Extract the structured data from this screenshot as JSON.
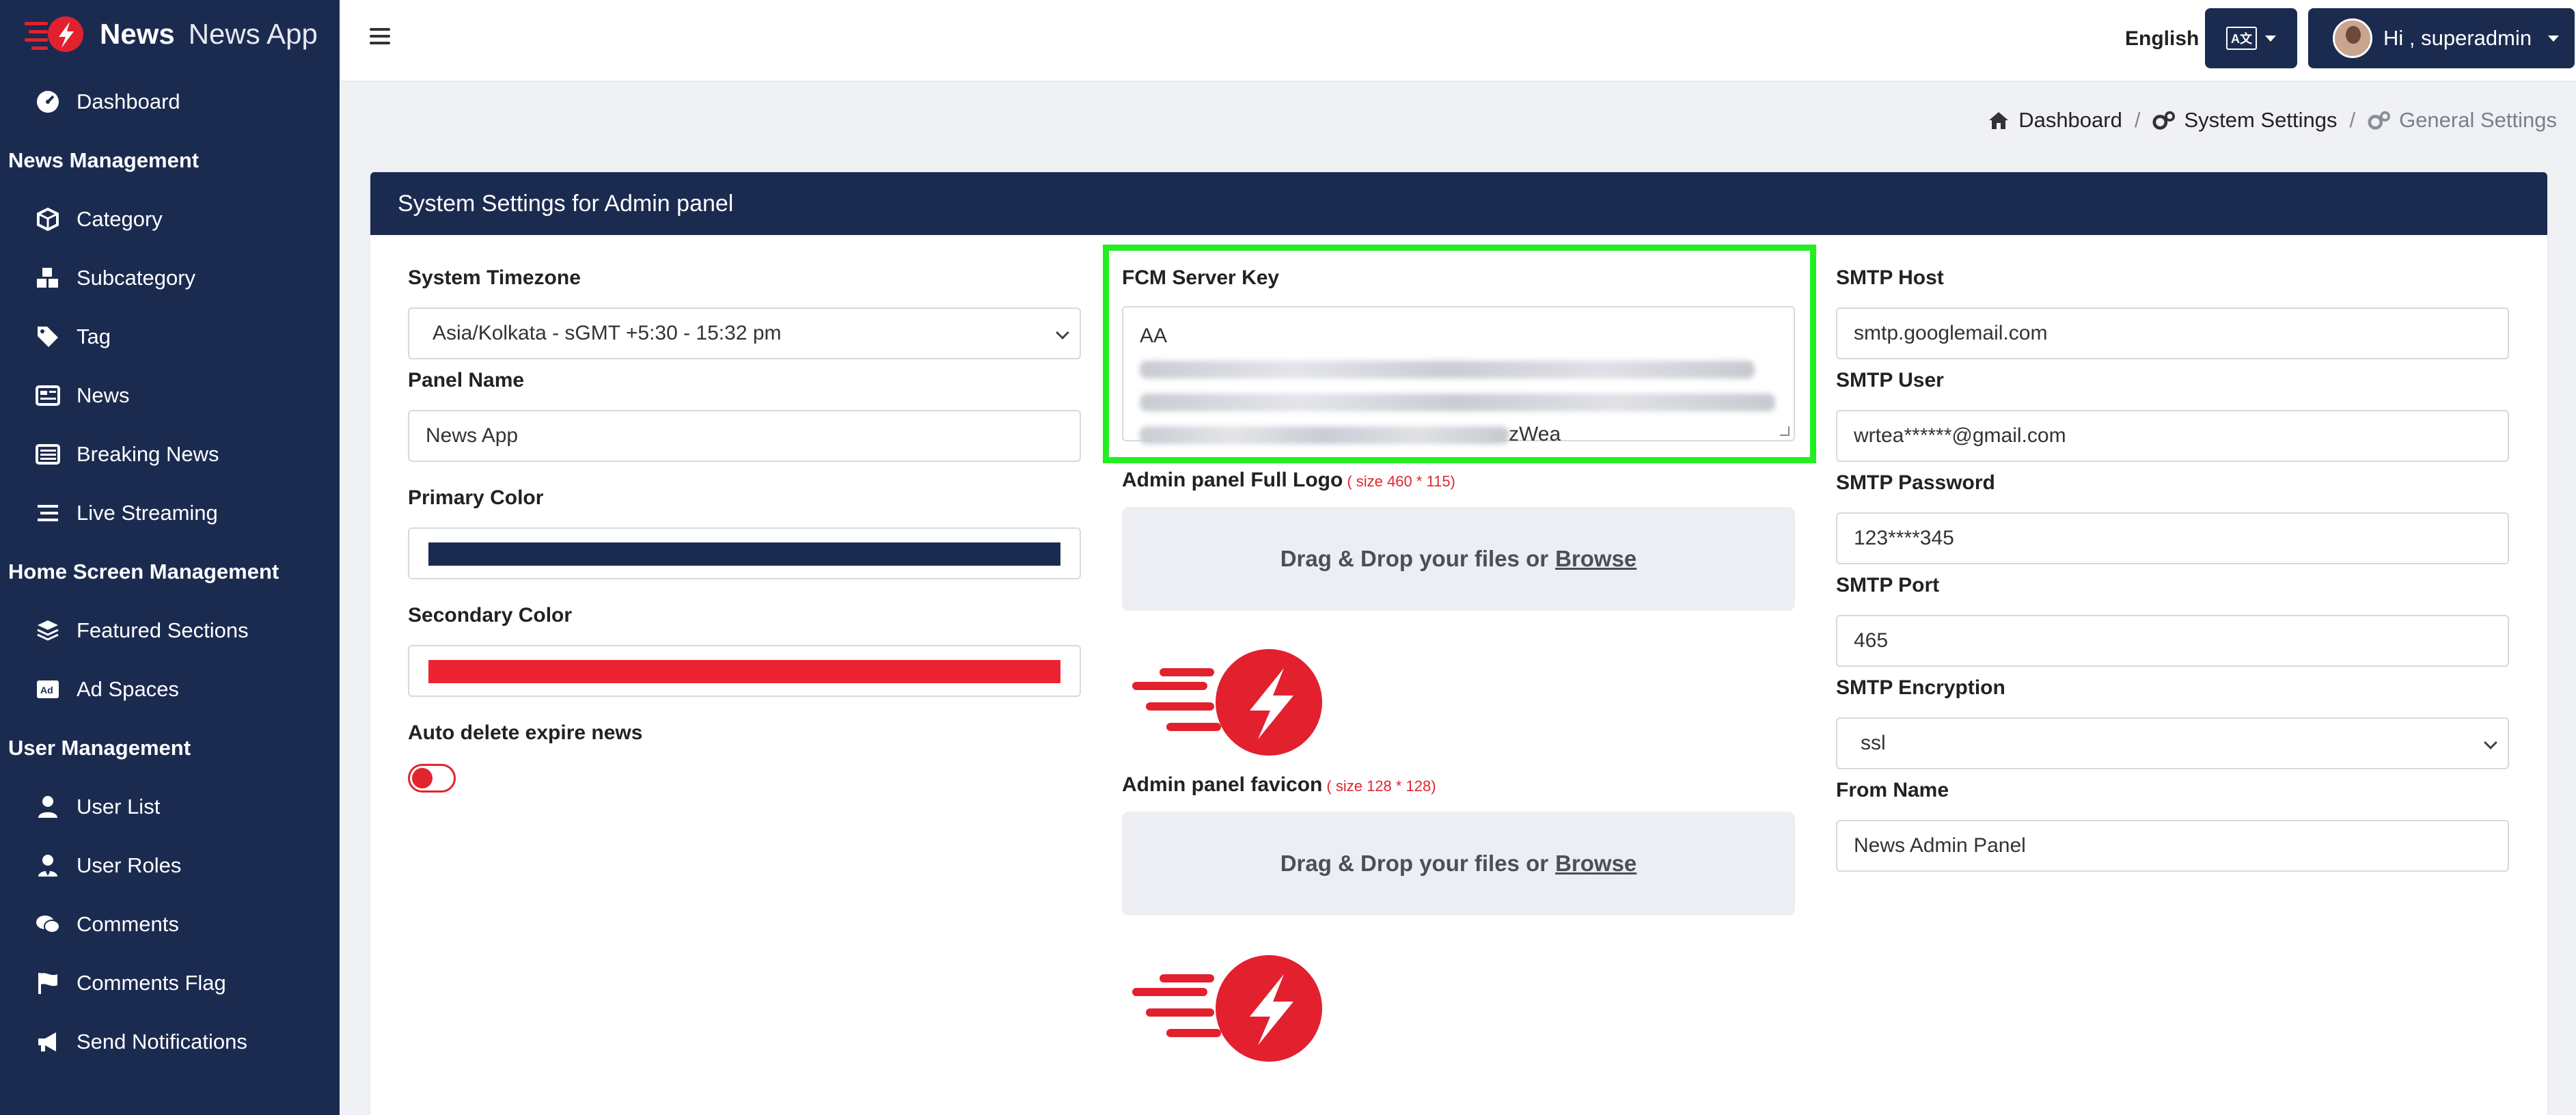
{
  "brand": {
    "name": "News",
    "subtitle": "News App"
  },
  "sidebar": {
    "dashboard": "Dashboard",
    "sections": [
      {
        "heading": "News Management",
        "items": [
          "Category",
          "Subcategory",
          "Tag",
          "News",
          "Breaking News",
          "Live Streaming"
        ]
      },
      {
        "heading": "Home Screen Management",
        "items": [
          "Featured Sections",
          "Ad Spaces"
        ]
      },
      {
        "heading": "User Management",
        "items": [
          "User List",
          "User Roles",
          "Comments",
          "Comments Flag",
          "Send Notifications"
        ]
      }
    ]
  },
  "topbar": {
    "language": "English",
    "lang_button_text": "A文",
    "user_greeting": "Hi , superadmin"
  },
  "breadcrumb": {
    "home": "Dashboard",
    "parent": "System Settings",
    "current": "General Settings",
    "separator": "/"
  },
  "card": {
    "title": "System Settings for Admin panel"
  },
  "form": {
    "timezone_label": "System Timezone",
    "timezone_value": "Asia/Kolkata - sGMT +5:30 - 15:32 pm",
    "panel_name_label": "Panel Name",
    "panel_name_value": "News App",
    "primary_color_label": "Primary Color",
    "primary_color": "#1b2b50",
    "secondary_color_label": "Secondary Color",
    "secondary_color": "#ee2332",
    "auto_delete_label": "Auto delete expire news",
    "fcm_label": "FCM Server Key",
    "fcm_prefix": "AA",
    "fcm_suffix": "zWea",
    "full_logo_label": "Admin panel Full Logo",
    "full_logo_hint": "( size 460 * 115)",
    "favicon_label": "Admin panel favicon",
    "favicon_hint": "( size 128 * 128)",
    "dropzone_text": "Drag & Drop your files or",
    "dropzone_link": "Browse",
    "smtp_host_label": "SMTP Host",
    "smtp_host_value": "smtp.googlemail.com",
    "smtp_user_label": "SMTP User",
    "smtp_user_value": "wrtea******@gmail.com",
    "smtp_password_label": "SMTP Password",
    "smtp_password_value": "123****345",
    "smtp_port_label": "SMTP Port",
    "smtp_port_value": "465",
    "smtp_encryption_label": "SMTP Encryption",
    "smtp_encryption_value": "ssl",
    "from_name_label": "From Name",
    "from_name_value": "News Admin Panel"
  },
  "colors": {
    "navy": "#1b2b50",
    "brand_red": "#e3202e",
    "highlight": "#22ee22"
  }
}
